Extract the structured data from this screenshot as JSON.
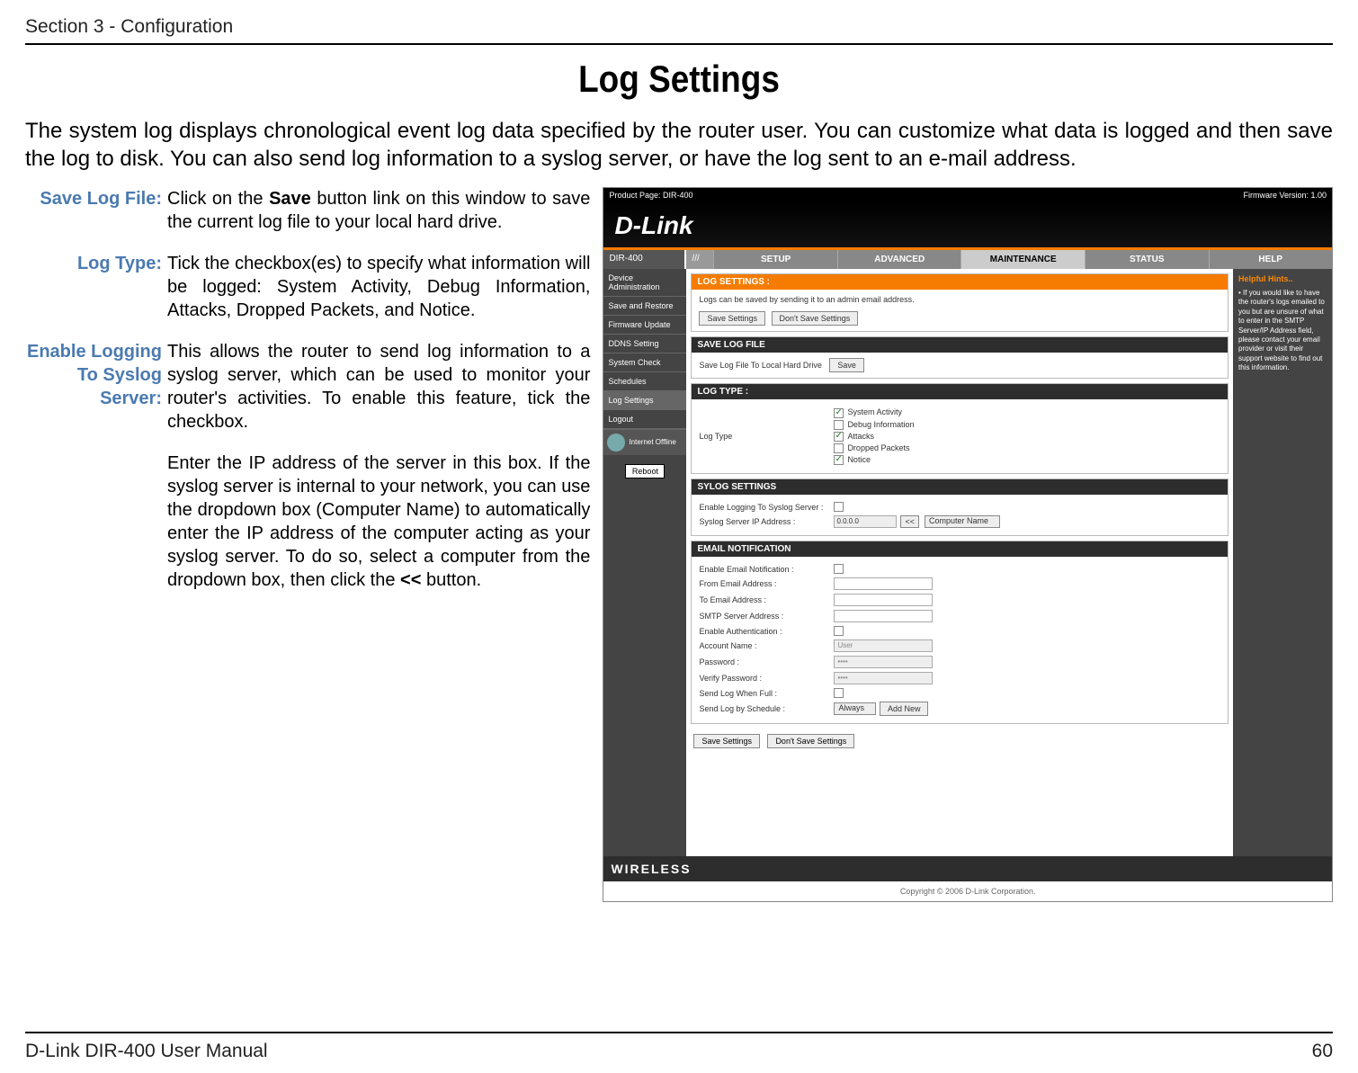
{
  "doc": {
    "section_header": "Section 3 - Configuration",
    "page_title": "Log Settings",
    "intro": "The system log displays chronological event log data specified by the router user. You can customize what data is logged and then save the log to disk.  You can also send log information to a syslog server, or have the log sent to an e-mail address.",
    "footer_left": "D-Link DIR-400 User Manual",
    "footer_right": "60"
  },
  "defs": {
    "save_log_file": {
      "label": "Save Log File:",
      "p1a": "Click on the ",
      "p1b": "Save",
      "p1c": " button link on this window to save the current log file to your local hard drive."
    },
    "log_type": {
      "label": "Log Type:",
      "p1": "Tick the checkbox(es) to specify what information will be logged: System Activity, Debug Information, Attacks, Dropped Packets, and Notice."
    },
    "syslog": {
      "label": "Enable Logging To Syslog Server:",
      "p1": "This allows the router to send log information to a syslog server, which can be used to monitor your router's activities.  To enable this feature, tick the checkbox.",
      "p2a": "Enter the IP address of the server in this box. If the syslog server is internal to your network, you can use the dropdown box (Computer Name) to automatically enter the IP address of the computer acting as your syslog server.  To do so, select a computer from the dropdown box, then click the ",
      "p2b": "<<",
      "p2c": " button."
    }
  },
  "router": {
    "top_left": "Product Page: DIR-400",
    "top_right": "Firmware Version: 1.00",
    "brand": "D-Link",
    "dir_label": "DIR-400",
    "tabs": [
      "SETUP",
      "ADVANCED",
      "MAINTENANCE",
      "STATUS",
      "HELP"
    ],
    "active_tab": 2,
    "side_items": [
      "Device Administration",
      "Save and Restore",
      "Firmware Update",
      "DDNS Setting",
      "System Check",
      "Schedules",
      "Log Settings",
      "Logout"
    ],
    "active_side": 6,
    "internet_label": "Internet Offline",
    "reboot": "Reboot",
    "hints_title": "Helpful Hints..",
    "hints_body": "• If you would like to have the router's logs emailed to you but are unsure of what to enter in the SMTP Server/IP Address field, please contact your email provider or visit their support website to find out this information.",
    "sec_log_settings": "LOG SETTINGS :",
    "log_settings_desc": "Logs can be saved by sending it to an admin email address.",
    "btn_save": "Save Settings",
    "btn_dont": "Don't Save Settings",
    "sec_save_log": "SAVE LOG FILE",
    "save_log_row": "Save Log File To Local Hard Drive",
    "save_btn": "Save",
    "sec_log_type": "LOG TYPE :",
    "log_type_label": "Log Type",
    "log_type_opts": [
      {
        "label": "System Activity",
        "checked": true
      },
      {
        "label": "Debug Information",
        "checked": false
      },
      {
        "label": "Attacks",
        "checked": true
      },
      {
        "label": "Dropped Packets",
        "checked": false
      },
      {
        "label": "Notice",
        "checked": true
      }
    ],
    "sec_syslog": "SYLOG SETTINGS",
    "syslog_enable_label": "Enable Logging To Syslog Server :",
    "syslog_ip_label": "Syslog Server IP Address :",
    "syslog_ip_value": "0.0.0.0",
    "syslog_ip_btn": "<<",
    "syslog_ip_select": "Computer Name",
    "sec_email": "EMAIL NOTIFICATION",
    "email_rows": [
      {
        "label": "Enable Email Notification :",
        "type": "check"
      },
      {
        "label": "From Email Address :",
        "type": "input"
      },
      {
        "label": "To Email Address :",
        "type": "input"
      },
      {
        "label": "SMTP Server Address :",
        "type": "input"
      },
      {
        "label": "Enable Authentication :",
        "type": "check"
      },
      {
        "label": "Account Name :",
        "type": "input",
        "gray": true,
        "value": "User"
      },
      {
        "label": "Password :",
        "type": "input",
        "gray": true,
        "value": "••••"
      },
      {
        "label": "Verify Password :",
        "type": "input",
        "gray": true,
        "value": "••••"
      },
      {
        "label": "Send Log When Full :",
        "type": "check"
      },
      {
        "label": "Send Log by Schedule :",
        "type": "schedule",
        "select": "Always",
        "btn": "Add New"
      }
    ],
    "footer_band": "WIRELESS",
    "copyright": "Copyright © 2006 D-Link Corporation."
  }
}
